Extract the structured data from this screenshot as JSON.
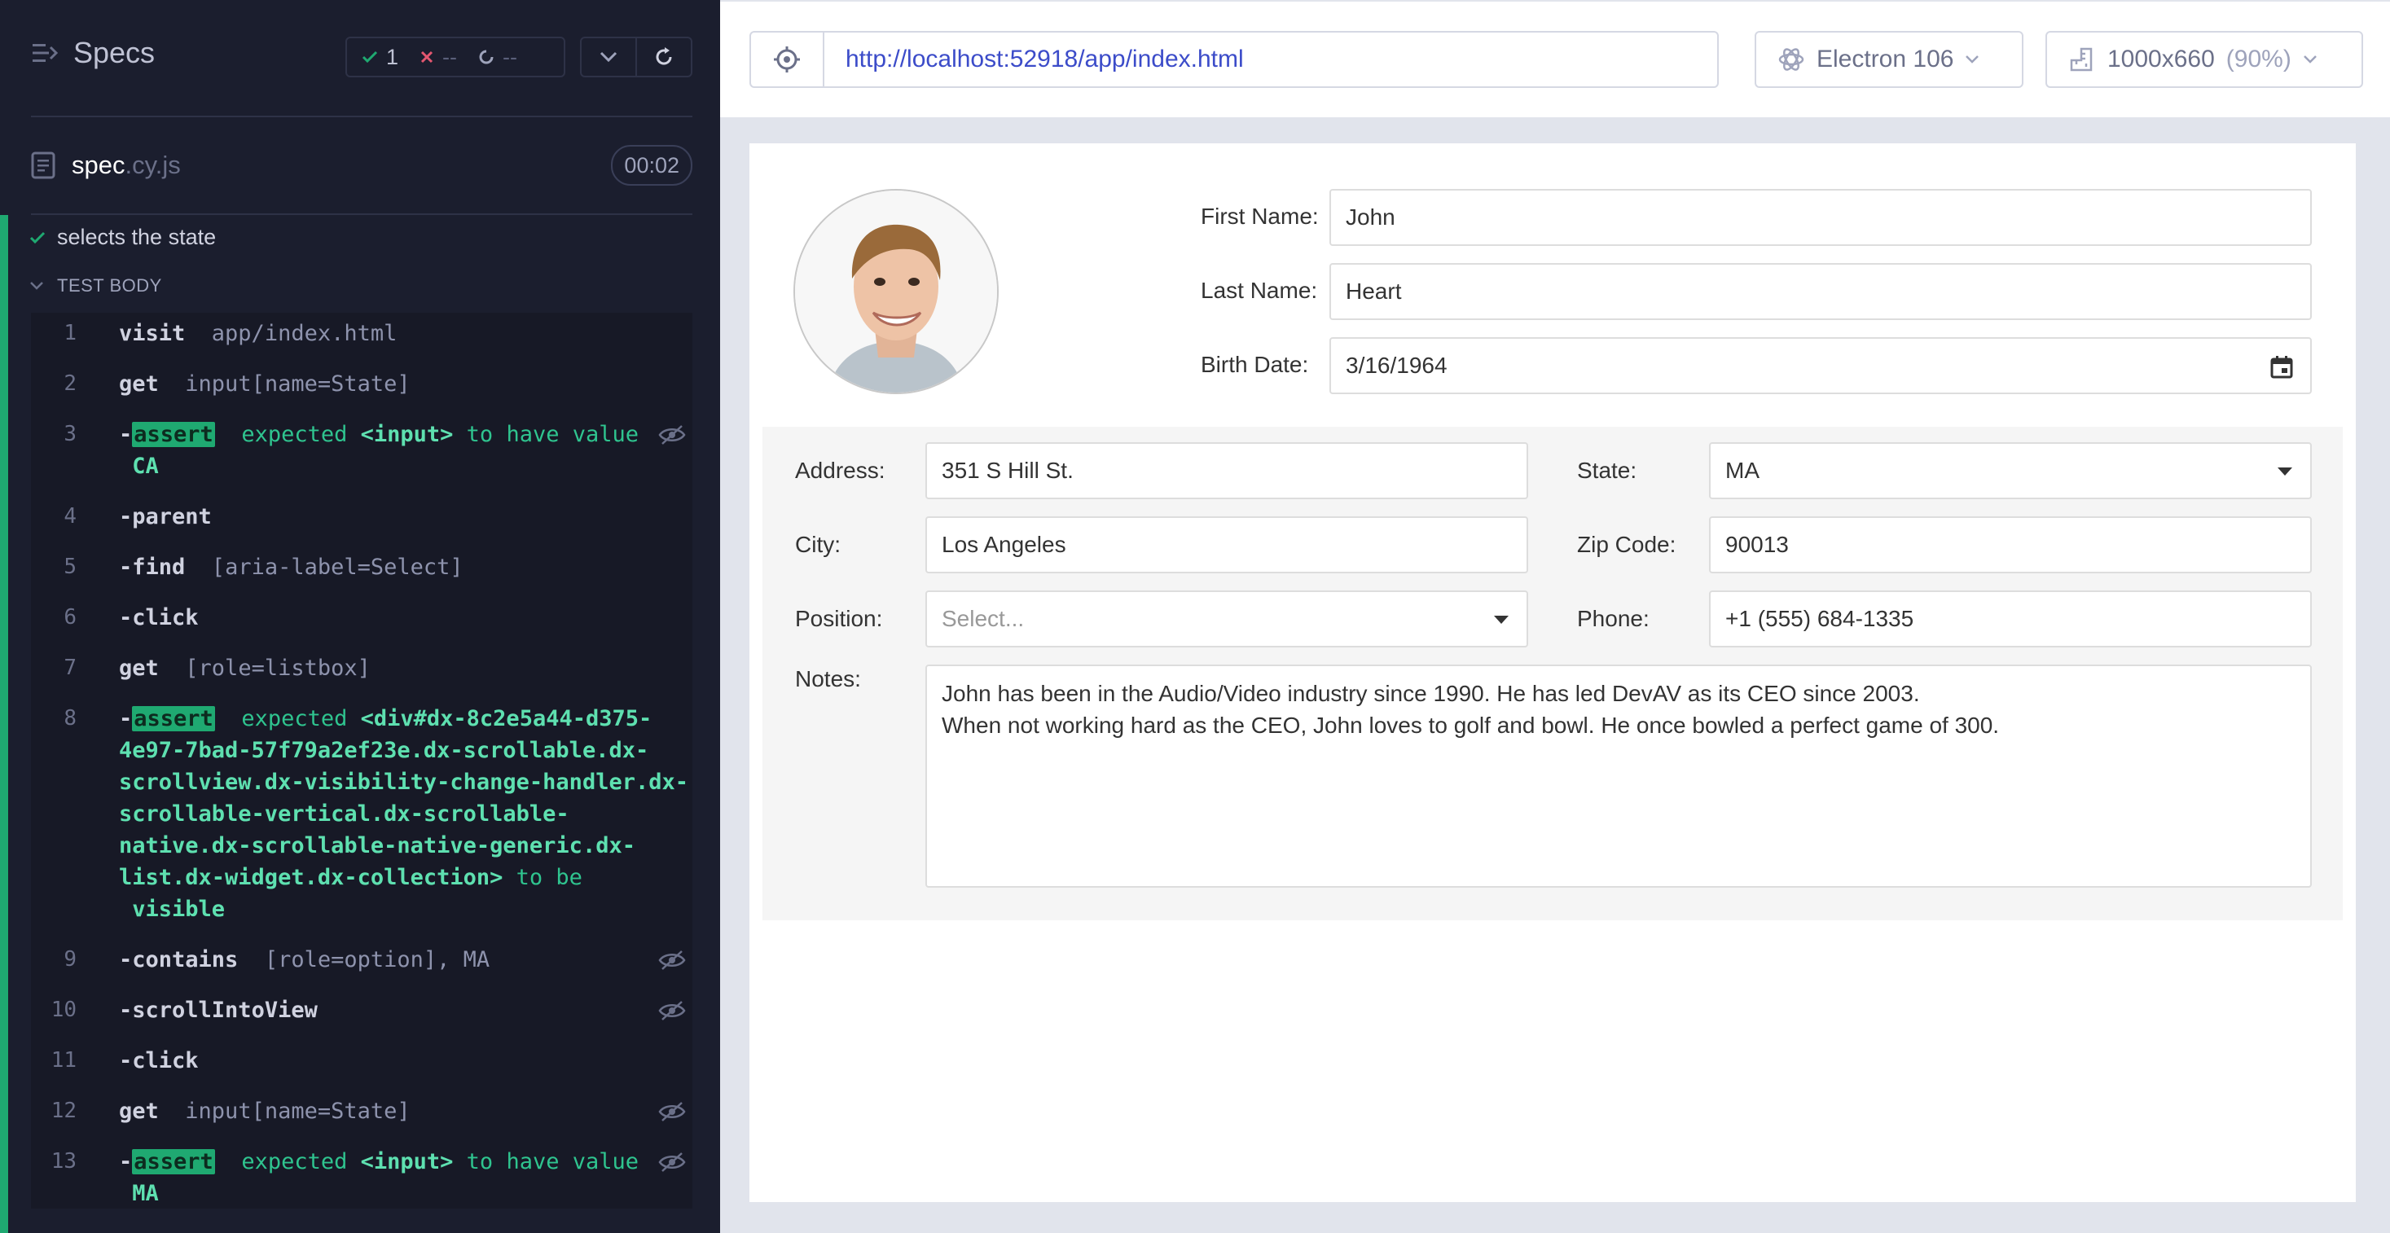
{
  "reporter": {
    "specs_label": "Specs",
    "stats": {
      "passed": "1",
      "failed": "--",
      "pending": "--"
    },
    "spec": {
      "name": "spec",
      "ext": ".cy.js",
      "duration": "00:02"
    },
    "test_title": "selects the state",
    "section_label": "TEST BODY",
    "commands": [
      {
        "num": "1",
        "lines": [
          [
            {
              "t": "visit",
              "c": "kw"
            },
            {
              "t": "  app/index.html",
              "c": "arg"
            }
          ]
        ]
      },
      {
        "num": "2",
        "lines": [
          [
            {
              "t": "get",
              "c": "kw"
            },
            {
              "t": "  input[name=State]",
              "c": "arg"
            }
          ]
        ]
      },
      {
        "num": "3",
        "eye": true,
        "lines": [
          [
            {
              "t": "-",
              "c": "dash"
            },
            {
              "t": "assert",
              "c": "assert-badge"
            },
            {
              "t": "  expected ",
              "c": "green"
            },
            {
              "t": "<input>",
              "c": "green-b"
            },
            {
              "t": " to have value",
              "c": "green"
            }
          ],
          [
            {
              "t": " CA",
              "c": "green-b"
            }
          ]
        ]
      },
      {
        "num": "4",
        "lines": [
          [
            {
              "t": "-",
              "c": "dash"
            },
            {
              "t": "parent",
              "c": "kw"
            }
          ]
        ]
      },
      {
        "num": "5",
        "lines": [
          [
            {
              "t": "-",
              "c": "dash"
            },
            {
              "t": "find",
              "c": "kw"
            },
            {
              "t": "  [aria-label=Select]",
              "c": "arg"
            }
          ]
        ]
      },
      {
        "num": "6",
        "lines": [
          [
            {
              "t": "-",
              "c": "dash"
            },
            {
              "t": "click",
              "c": "kw"
            }
          ]
        ]
      },
      {
        "num": "7",
        "lines": [
          [
            {
              "t": "get",
              "c": "kw"
            },
            {
              "t": "  [role=listbox]",
              "c": "arg"
            }
          ]
        ]
      },
      {
        "num": "8",
        "lines": [
          [
            {
              "t": "-",
              "c": "dash"
            },
            {
              "t": "assert",
              "c": "assert-badge"
            },
            {
              "t": "  expected ",
              "c": "green"
            },
            {
              "t": "<div#dx-8c2e5a44-d375-",
              "c": "green-b"
            }
          ],
          [
            {
              "t": "4e97-7bad-57f79a2ef23e.dx-scrollable.dx-",
              "c": "green-b"
            }
          ],
          [
            {
              "t": "scrollview.dx-visibility-change-handler.dx-",
              "c": "green-b"
            }
          ],
          [
            {
              "t": "scrollable-vertical.dx-scrollable-",
              "c": "green-b"
            }
          ],
          [
            {
              "t": "native.dx-scrollable-native-generic.dx-",
              "c": "green-b"
            }
          ],
          [
            {
              "t": "list.dx-widget.dx-collection>",
              "c": "green-b"
            },
            {
              "t": " to be",
              "c": "green"
            }
          ],
          [
            {
              "t": " visible",
              "c": "green-b"
            }
          ]
        ]
      },
      {
        "num": "9",
        "eye": true,
        "lines": [
          [
            {
              "t": "-",
              "c": "dash"
            },
            {
              "t": "contains",
              "c": "kw"
            },
            {
              "t": "  [role=option], MA",
              "c": "arg"
            }
          ]
        ]
      },
      {
        "num": "10",
        "eye": true,
        "lines": [
          [
            {
              "t": "-",
              "c": "dash"
            },
            {
              "t": "scrollIntoView",
              "c": "kw"
            }
          ]
        ]
      },
      {
        "num": "11",
        "lines": [
          [
            {
              "t": "-",
              "c": "dash"
            },
            {
              "t": "click",
              "c": "kw"
            }
          ]
        ]
      },
      {
        "num": "12",
        "eye": true,
        "lines": [
          [
            {
              "t": "get",
              "c": "kw"
            },
            {
              "t": "  input[name=State]",
              "c": "arg"
            }
          ]
        ]
      },
      {
        "num": "13",
        "eye": true,
        "lines": [
          [
            {
              "t": "-",
              "c": "dash"
            },
            {
              "t": "assert",
              "c": "assert-badge"
            },
            {
              "t": "  expected ",
              "c": "green"
            },
            {
              "t": "<input>",
              "c": "green-b"
            },
            {
              "t": " to have value",
              "c": "green"
            }
          ],
          [
            {
              "t": " MA",
              "c": "green-b"
            }
          ]
        ]
      }
    ]
  },
  "aut": {
    "url": "http://localhost:52918/app/index.html",
    "browser": "Electron 106",
    "viewport": "1000x660",
    "scale": "(90%)"
  },
  "form": {
    "first_name": {
      "label": "First Name:",
      "value": "John"
    },
    "last_name": {
      "label": "Last Name:",
      "value": "Heart"
    },
    "birth_date": {
      "label": "Birth Date:",
      "value": "3/16/1964"
    },
    "address": {
      "label": "Address:",
      "value": "351 S Hill St."
    },
    "state": {
      "label": "State:",
      "value": "MA"
    },
    "city": {
      "label": "City:",
      "value": "Los Angeles"
    },
    "zip": {
      "label": "Zip Code:",
      "value": "90013"
    },
    "position": {
      "label": "Position:",
      "placeholder": "Select..."
    },
    "phone": {
      "label": "Phone:",
      "value": "+1 (555) 684-1335"
    },
    "notes": {
      "label": "Notes:",
      "line1": "John has been in the Audio/Video industry since 1990. He has led DevAV as its CEO since 2003.",
      "line2": "When not working hard as the CEO, John loves to golf and bowl. He once bowled a perfect game of 300."
    }
  },
  "colors": {
    "pass": "#1fa971",
    "fail": "#e45770",
    "link": "#3c4cc9",
    "reporter_bg": "#1b1e2e"
  }
}
